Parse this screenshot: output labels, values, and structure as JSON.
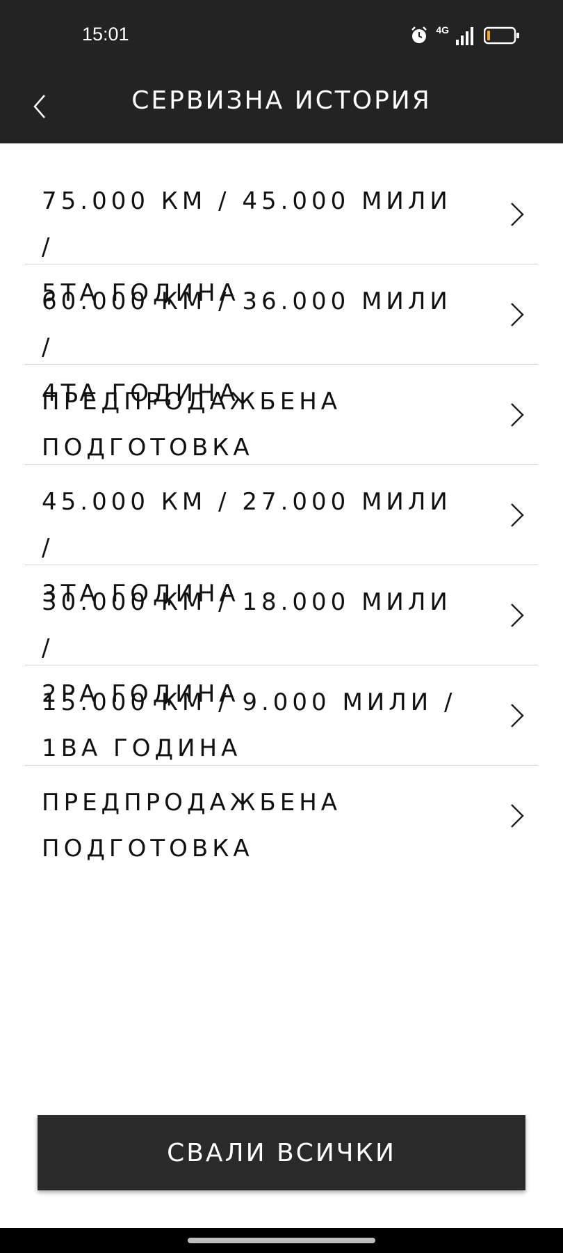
{
  "status_bar": {
    "time": "15:01",
    "network": "4G",
    "icons": [
      "alarm-icon",
      "signal-icon",
      "battery-icon"
    ]
  },
  "header": {
    "title": "СЕРВИЗНА ИСТОРИЯ",
    "back_icon": "chevron-left-icon"
  },
  "service_items": [
    {
      "line1": "75.000 КМ / 45.000 МИЛИ /",
      "line2": "5ТА ГОДИНА"
    },
    {
      "line1": "60.000 КМ / 36.000 МИЛИ /",
      "line2": "4ТА ГОДИНА"
    },
    {
      "line1": "ПРЕДПРОДАЖБЕНА",
      "line2": "ПОДГОТОВКА"
    },
    {
      "line1": "45.000 КМ / 27.000 МИЛИ /",
      "line2": "3ТА ГОДИНА"
    },
    {
      "line1": "30.000 КМ / 18.000 МИЛИ /",
      "line2": "2РА ГОДИНА"
    },
    {
      "line1": "15.000 КМ / 9.000 МИЛИ /",
      "line2": "1ВА ГОДИНА"
    },
    {
      "line1": "ПРЕДПРОДАЖБЕНА",
      "line2": "ПОДГОТОВКА"
    }
  ],
  "download_button": {
    "label": "СВАЛИ ВСИЧКИ"
  },
  "colors": {
    "header_bg": "#232323",
    "button_bg": "#2a2a2a",
    "divider": "#d6d6d6"
  }
}
